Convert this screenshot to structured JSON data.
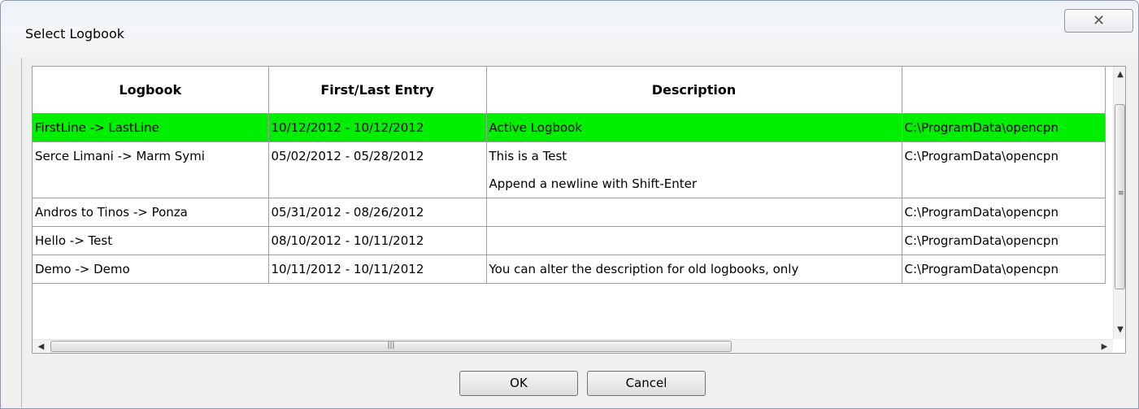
{
  "window": {
    "title": "Select Logbook",
    "close_icon": "close-icon"
  },
  "table": {
    "columns": [
      "Logbook",
      "First/Last Entry",
      "Description",
      ""
    ],
    "rows": [
      {
        "logbook": "FirstLine  -> LastLine",
        "entry": "10/12/2012 - 10/12/2012",
        "description": [
          "Active Logbook"
        ],
        "path": "C:\\ProgramData\\opencpn",
        "selected": true
      },
      {
        "logbook": "Serce Limani  -> Marm Symi",
        "entry": "05/02/2012 - 05/28/2012",
        "description": [
          "This is a Test",
          "Append a newline with Shift-Enter"
        ],
        "path": "C:\\ProgramData\\opencpn",
        "selected": false
      },
      {
        "logbook": "Andros to Tinos  -> Ponza",
        "entry": "05/31/2012 - 08/26/2012",
        "description": [
          ""
        ],
        "path": "C:\\ProgramData\\opencpn",
        "selected": false
      },
      {
        "logbook": "Hello  -> Test",
        "entry": "08/10/2012 - 10/11/2012",
        "description": [
          ""
        ],
        "path": "C:\\ProgramData\\opencpn",
        "selected": false
      },
      {
        "logbook": "Demo  -> Demo",
        "entry": "10/11/2012 - 10/11/2012",
        "description": [
          "You can alter the description for old logbooks, only"
        ],
        "path": "C:\\ProgramData\\opencpn",
        "selected": false
      }
    ],
    "selected_color": "#00ee00"
  },
  "buttons": {
    "ok": "OK",
    "cancel": "Cancel"
  }
}
